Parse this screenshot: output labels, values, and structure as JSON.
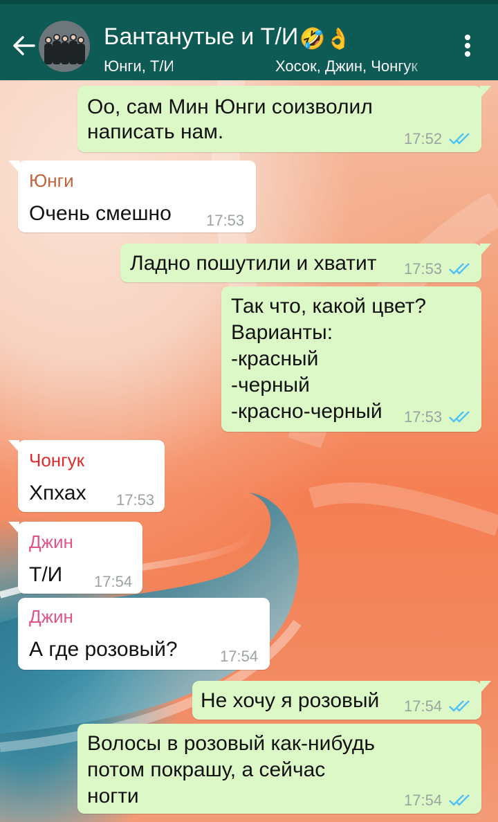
{
  "chat": {
    "title": "Бантанутые и Т/И",
    "title_emojis": "🤣👌",
    "subtitle_left": "Юнги, Т/И",
    "subtitle_right": "Хосок, Джин, Чонгук",
    "back_icon": "arrow-left-icon",
    "menu_icon": "more-vert-icon"
  },
  "colors": {
    "header": "#0e5b55",
    "outgoing_bubble": "#dcf8c6",
    "incoming_bubble": "#ffffff",
    "read_ticks": "#4fc3f7",
    "sender_yungi": "#c0623a",
    "sender_jungkook": "#e02a2a",
    "sender_jin": "#e0528a"
  },
  "messages": [
    {
      "direction": "out",
      "lines": [
        "Оо, сам Мин Юнги соизволил",
        "написать нам."
      ],
      "time": "17:52",
      "status": "read"
    },
    {
      "direction": "in",
      "sender": "Юнги",
      "lines": [
        "Очень смешно"
      ],
      "time": "17:53"
    },
    {
      "direction": "out",
      "lines": [
        "Ладно пошутили и хватит"
      ],
      "time": "17:53",
      "status": "read"
    },
    {
      "direction": "out",
      "lines": [
        "Так что, какой цвет?",
        "Варианты:",
        "-красный",
        "-черный",
        "-красно-черный"
      ],
      "time": "17:53",
      "status": "read"
    },
    {
      "direction": "in",
      "sender": "Чонгук",
      "lines": [
        "Хпхах"
      ],
      "time": "17:53"
    },
    {
      "direction": "in",
      "sender": "Джин",
      "lines": [
        "Т/И"
      ],
      "time": "17:54"
    },
    {
      "direction": "in",
      "sender": "Джин",
      "lines": [
        "А где розовый?"
      ],
      "time": "17:54"
    },
    {
      "direction": "out",
      "lines": [
        "Не хочу я розовый"
      ],
      "time": "17:54",
      "status": "read"
    },
    {
      "direction": "out",
      "lines": [
        "Волосы в розовый как-нибудь",
        "потом покрашу, а сейчас",
        "ногти"
      ],
      "time": "17:54",
      "status": "read"
    }
  ]
}
